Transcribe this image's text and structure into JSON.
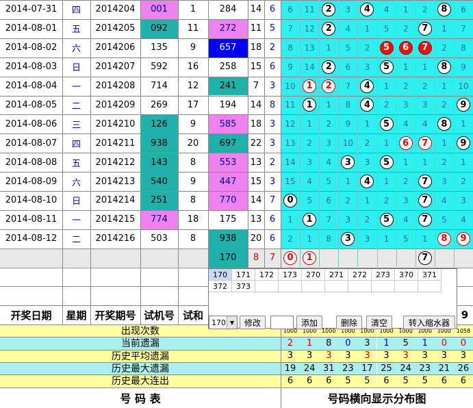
{
  "rows": [
    {
      "date": "2014-07-31",
      "week": "四",
      "period": "2014204",
      "trial": "001",
      "sum": "1",
      "open": "284",
      "s2": "14",
      "s3": "6",
      "dist": [
        "6",
        "11",
        "2",
        "3",
        "4",
        "4",
        "1",
        "2",
        "8",
        "6"
      ]
    },
    {
      "date": "2014-08-01",
      "week": "五",
      "period": "2014205",
      "trial": "092",
      "sum": "11",
      "open": "272",
      "s2": "11",
      "s3": "5",
      "dist": [
        "7",
        "12",
        "2",
        "4",
        "1",
        "5",
        "2",
        "7",
        "1",
        "7"
      ]
    },
    {
      "date": "2014-08-02",
      "week": "六",
      "period": "2014206",
      "trial": "135",
      "sum": "9",
      "open": "657",
      "s2": "18",
      "s3": "2",
      "dist": [
        "8",
        "13",
        "1",
        "5",
        "2",
        "5",
        "6",
        "7",
        "2",
        "8"
      ]
    },
    {
      "date": "2014-08-03",
      "week": "日",
      "period": "2014207",
      "trial": "592",
      "sum": "16",
      "open": "258",
      "s2": "15",
      "s3": "6",
      "dist": [
        "9",
        "14",
        "2",
        "6",
        "3",
        "5",
        "1",
        "1",
        "8",
        "9"
      ]
    },
    {
      "date": "2014-08-04",
      "week": "一",
      "period": "2014208",
      "trial": "714",
      "sum": "12",
      "open": "241",
      "s2": "7",
      "s3": "3",
      "dist": [
        "10",
        "1",
        "2",
        "7",
        "4",
        "1",
        "2",
        "2",
        "1",
        "10"
      ]
    },
    {
      "date": "2014-08-05",
      "week": "二",
      "period": "2014209",
      "trial": "269",
      "sum": "17",
      "open": "194",
      "s2": "14",
      "s3": "8",
      "dist": [
        "11",
        "1",
        "1",
        "8",
        "4",
        "2",
        "3",
        "3",
        "2",
        "9"
      ]
    },
    {
      "date": "2014-08-06",
      "week": "三",
      "period": "2014210",
      "trial": "126",
      "sum": "9",
      "open": "585",
      "s2": "18",
      "s3": "3",
      "dist": [
        "12",
        "1",
        "2",
        "9",
        "1",
        "5",
        "4",
        "4",
        "8",
        "1"
      ]
    },
    {
      "date": "2014-08-07",
      "week": "四",
      "period": "2014211",
      "trial": "938",
      "sum": "20",
      "open": "697",
      "s2": "22",
      "s3": "3",
      "dist": [
        "13",
        "2",
        "3",
        "10",
        "2",
        "1",
        "6",
        "7",
        "1",
        "9"
      ]
    },
    {
      "date": "2014-08-08",
      "week": "五",
      "period": "2014212",
      "trial": "143",
      "sum": "8",
      "open": "553",
      "s2": "13",
      "s3": "2",
      "dist": [
        "14",
        "3",
        "4",
        "3",
        "3",
        "5",
        "1",
        "1",
        "2",
        "1"
      ]
    },
    {
      "date": "2014-08-09",
      "week": "六",
      "period": "2014213",
      "trial": "540",
      "sum": "9",
      "open": "447",
      "s2": "15",
      "s3": "3",
      "dist": [
        "15",
        "4",
        "5",
        "1",
        "4",
        "1",
        "2",
        "7",
        "3",
        "2"
      ]
    },
    {
      "date": "2014-08-10",
      "week": "日",
      "period": "2014214",
      "trial": "251",
      "sum": "8",
      "open": "770",
      "s2": "14",
      "s3": "7",
      "dist": [
        "0",
        "5",
        "6",
        "2",
        "1",
        "2",
        "3",
        "7",
        "4",
        "3"
      ]
    },
    {
      "date": "2014-08-11",
      "week": "一",
      "period": "2014215",
      "trial": "774",
      "sum": "18",
      "open": "175",
      "s2": "13",
      "s3": "6",
      "dist": [
        "1",
        "1",
        "7",
        "3",
        "2",
        "5",
        "4",
        "7",
        "5",
        "4"
      ]
    },
    {
      "date": "2014-08-12",
      "week": "二",
      "period": "2014216",
      "trial": "503",
      "sum": "8",
      "open": "938",
      "s2": "20",
      "s3": "6",
      "dist": [
        "2",
        "1",
        "8",
        "3",
        "3",
        "1",
        "5",
        "1",
        "8",
        "9"
      ]
    }
  ],
  "ball_map": [
    {
      "2": "black",
      "4": "black",
      "8": "black"
    },
    {
      "2": "black",
      "7": "black"
    },
    {
      "5": "red",
      "6": "red",
      "7": "red"
    },
    {
      "2": "black",
      "5": "black",
      "8": "black"
    },
    {
      "1": "redout",
      "2": "redout",
      "4": "black"
    },
    {
      "1": "black",
      "4": "black",
      "9": "black"
    },
    {
      "5": "black",
      "8": "black"
    },
    {
      "6": "redout",
      "7": "redout",
      "9": "black"
    },
    {
      "3": "black",
      "5": "black"
    },
    {
      "4": "black",
      "7": "black"
    },
    {
      "0": "black",
      "7": "black"
    },
    {
      "1": "black",
      "5": "black",
      "7": "black"
    },
    {
      "3": "black",
      "8": "redout",
      "9": "redout"
    }
  ],
  "pending": {
    "open": "170",
    "s2": "8",
    "s3": "7",
    "balls": [
      {
        "col": 0,
        "v": "0"
      },
      {
        "col": 1,
        "v": "1"
      },
      {
        "col": 7,
        "v": "7"
      }
    ]
  },
  "header": {
    "date": "开奖日期",
    "week": "星期",
    "period": "开奖期号",
    "trial": "试机号",
    "sum": "试和",
    "tail": "9"
  },
  "stats": {
    "labels": [
      "出现次数",
      "当前遗漏",
      "历史平均遗漏",
      "历史最大遗漏",
      "历史最大连出"
    ],
    "appear": [
      "1000",
      "1000",
      "1000",
      "1000",
      "1000",
      "1000",
      "1000",
      "1000",
      "1000",
      "1058"
    ],
    "current": [
      "2",
      "1",
      "8",
      "0",
      "3",
      "1",
      "5",
      "1",
      "0",
      "0"
    ],
    "average": [
      "3",
      "3",
      "3",
      "3",
      "3",
      "3",
      "3",
      "3",
      "3",
      "3"
    ],
    "max_miss": [
      "19",
      "24",
      "31",
      "23",
      "17",
      "25",
      "24",
      "23",
      "21",
      "26"
    ],
    "max_streak": [
      "6",
      "6",
      "6",
      "5",
      "5",
      "6",
      "5",
      "5",
      "6",
      "6"
    ]
  },
  "footer": {
    "left": "号 码 表",
    "right": "号码横向显示分布图"
  },
  "popup": {
    "items": [
      "170",
      "171",
      "172",
      "173",
      "270",
      "271",
      "272",
      "273",
      "370",
      "371",
      "372",
      "373"
    ],
    "select_value": "170",
    "buttons": {
      "modify": "修改",
      "add": "添加",
      "delete": "删除",
      "clear": "清空",
      "shrink": "转入缩水器"
    }
  },
  "colors": {
    "teal": "#20b2aa",
    "pink": "#ee82ee",
    "blue": "#0000ff",
    "cyan": "#2ff0f0",
    "yellow": "#ffffa0"
  }
}
